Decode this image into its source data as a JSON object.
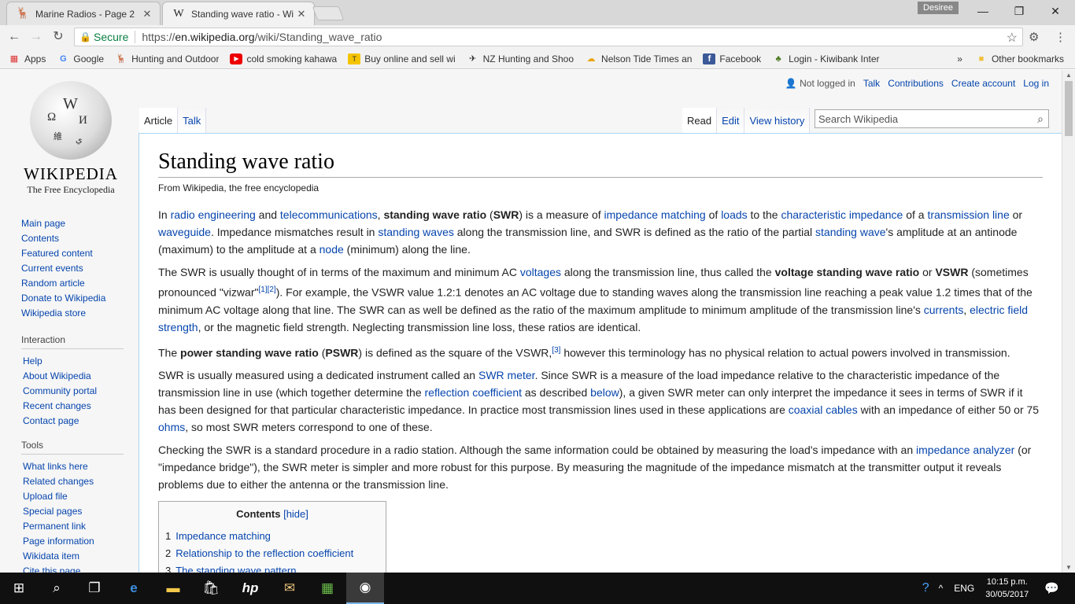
{
  "browser": {
    "tabs": [
      {
        "title": "Marine Radios - Page 2",
        "icon": "deer-icon"
      },
      {
        "title": "Standing wave ratio - Wi",
        "icon": "wikipedia-icon"
      }
    ],
    "user_badge": "Desiree",
    "window_controls": {
      "minimize": "—",
      "restore": "❐",
      "close": "✕"
    },
    "secure_label": "Secure",
    "url_prefix": "https://",
    "url_host": "en.wikipedia.org",
    "url_path": "/wiki/Standing_wave_ratio",
    "bookmarks": [
      {
        "label": "Apps",
        "icon": "apps-grid-icon"
      },
      {
        "label": "Google",
        "icon": "google-icon"
      },
      {
        "label": "Hunting and Outdoor",
        "icon": "deer-icon"
      },
      {
        "label": "cold smoking kahawa",
        "icon": "youtube-icon"
      },
      {
        "label": "Buy online and sell wi",
        "icon": "trademe-icon"
      },
      {
        "label": "NZ Hunting and Shoo",
        "icon": "hunting-icon"
      },
      {
        "label": "Nelson Tide Times an",
        "icon": "weather-icon"
      },
      {
        "label": "Facebook",
        "icon": "facebook-icon"
      },
      {
        "label": "Login - Kiwibank Inter",
        "icon": "kiwibank-icon"
      }
    ],
    "bookmarks_overflow": "»",
    "other_bookmarks": "Other bookmarks"
  },
  "wiki": {
    "personal": {
      "not_logged_in": "Not logged in",
      "talk": "Talk",
      "contributions": "Contributions",
      "create_account": "Create account",
      "log_in": "Log in"
    },
    "logo": {
      "wordmark": "Wikipedia",
      "tagline": "The Free Encyclopedia"
    },
    "nav_main": [
      "Main page",
      "Contents",
      "Featured content",
      "Current events",
      "Random article",
      "Donate to Wikipedia",
      "Wikipedia store"
    ],
    "interaction": {
      "heading": "Interaction",
      "items": [
        "Help",
        "About Wikipedia",
        "Community portal",
        "Recent changes",
        "Contact page"
      ]
    },
    "tools": {
      "heading": "Tools",
      "items": [
        "What links here",
        "Related changes",
        "Upload file",
        "Special pages",
        "Permanent link",
        "Page information",
        "Wikidata item",
        "Cite this page"
      ]
    },
    "tabs_left": [
      "Article",
      "Talk"
    ],
    "tabs_right": [
      "Read",
      "Edit",
      "View history"
    ],
    "search_placeholder": "Search Wikipedia",
    "title": "Standing wave ratio",
    "subtitle": "From Wikipedia, the free encyclopedia",
    "paragraphs": [
      [
        {
          "t": "In "
        },
        {
          "l": "radio engineering"
        },
        {
          "t": " and "
        },
        {
          "l": "telecommunications"
        },
        {
          "t": ", "
        },
        {
          "b": "standing wave ratio"
        },
        {
          "t": " ("
        },
        {
          "b": "SWR"
        },
        {
          "t": ") is a measure of "
        },
        {
          "l": "impedance matching"
        },
        {
          "t": " of "
        },
        {
          "l": "loads"
        },
        {
          "t": " to the "
        },
        {
          "l": "characteristic impedance"
        },
        {
          "t": " of a "
        },
        {
          "l": "transmission line"
        },
        {
          "t": " or "
        },
        {
          "l": "waveguide"
        },
        {
          "t": ". Impedance mismatches result in "
        },
        {
          "l": "standing waves"
        },
        {
          "t": " along the transmission line, and SWR is defined as the ratio of the partial "
        },
        {
          "l": "standing wave"
        },
        {
          "t": "'s amplitude at an antinode (maximum) to the amplitude at a "
        },
        {
          "l": "node"
        },
        {
          "t": " (minimum) along the line."
        }
      ],
      [
        {
          "t": "The SWR is usually thought of in terms of the maximum and minimum AC "
        },
        {
          "l": "voltages"
        },
        {
          "t": " along the transmission line, thus called the "
        },
        {
          "b": "voltage standing wave ratio"
        },
        {
          "t": " or "
        },
        {
          "b": "VSWR"
        },
        {
          "t": " (sometimes pronounced \"vizwar\""
        },
        {
          "s": "[1]"
        },
        {
          "s": "[2]"
        },
        {
          "t": "). For example, the VSWR value 1.2:1 denotes an AC voltage due to standing waves along the transmission line reaching a peak value 1.2 times that of the minimum AC voltage along that line. The SWR can as well be defined as the ratio of the maximum amplitude to minimum amplitude of the transmission line's "
        },
        {
          "l": "currents"
        },
        {
          "t": ", "
        },
        {
          "l": "electric field strength"
        },
        {
          "t": ", or the magnetic field strength. Neglecting transmission line loss, these ratios are identical."
        }
      ],
      [
        {
          "t": "The "
        },
        {
          "b": "power standing wave ratio"
        },
        {
          "t": " ("
        },
        {
          "b": "PSWR"
        },
        {
          "t": ") is defined as the square of the VSWR,"
        },
        {
          "s": "[3]"
        },
        {
          "t": " however this terminology has no physical relation to actual powers involved in transmission."
        }
      ],
      [
        {
          "t": "SWR is usually measured using a dedicated instrument called an "
        },
        {
          "l": "SWR meter"
        },
        {
          "t": ". Since SWR is a measure of the load impedance relative to the characteristic impedance of the transmission line in use (which together determine the "
        },
        {
          "l": "reflection coefficient"
        },
        {
          "t": " as described "
        },
        {
          "l": "below"
        },
        {
          "t": "), a given SWR meter can only interpret the impedance it sees in terms of SWR if it has been designed for that particular characteristic impedance. In practice most transmission lines used in these applications are "
        },
        {
          "l": "coaxial cables"
        },
        {
          "t": " with an impedance of either 50 or 75 "
        },
        {
          "l": "ohms"
        },
        {
          "t": ", so most SWR meters correspond to one of these."
        }
      ],
      [
        {
          "t": "Checking the SWR is a standard procedure in a radio station. Although the same information could be obtained by measuring the load's impedance with an "
        },
        {
          "l": "impedance analyzer"
        },
        {
          "t": " (or \"impedance bridge\"), the SWR meter is simpler and more robust for this purpose. By measuring the magnitude of the impedance mismatch at the transmitter output it reveals problems due to either the antenna or the transmission line."
        }
      ]
    ],
    "toc": {
      "title": "Contents",
      "hide": "[hide]",
      "items": [
        {
          "num": "1",
          "label": "Impedance matching"
        },
        {
          "num": "2",
          "label": "Relationship to the reflection coefficient"
        },
        {
          "num": "3",
          "label": "The standing wave pattern"
        }
      ]
    }
  },
  "taskbar": {
    "lang": "ENG",
    "time": "10:15 p.m.",
    "date": "30/05/2017"
  }
}
